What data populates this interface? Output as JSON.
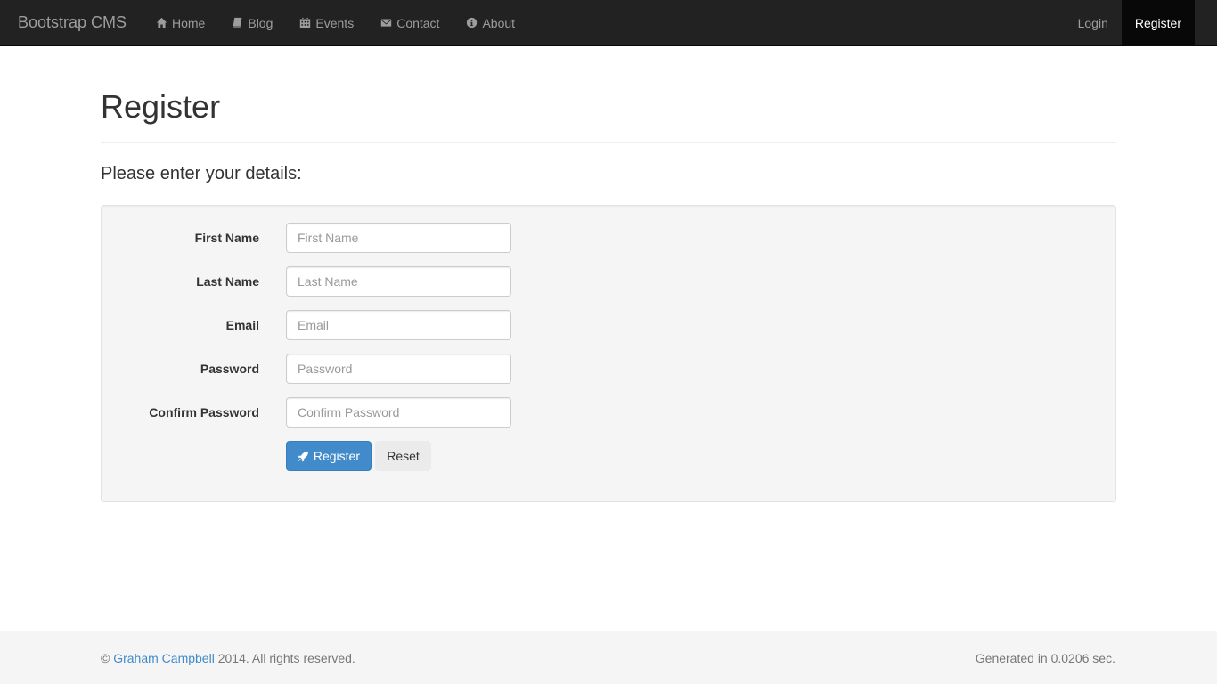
{
  "navbar": {
    "brand": "Bootstrap CMS",
    "links": [
      {
        "label": "Home",
        "icon": "home-icon"
      },
      {
        "label": "Blog",
        "icon": "book-icon"
      },
      {
        "label": "Events",
        "icon": "calendar-icon"
      },
      {
        "label": "Contact",
        "icon": "envelope-icon"
      },
      {
        "label": "About",
        "icon": "info-icon"
      }
    ],
    "right": {
      "login": "Login",
      "register": "Register"
    }
  },
  "page": {
    "title": "Register",
    "subtitle": "Please enter your details:"
  },
  "form": {
    "fields": [
      {
        "label": "First Name",
        "placeholder": "First Name"
      },
      {
        "label": "Last Name",
        "placeholder": "Last Name"
      },
      {
        "label": "Email",
        "placeholder": "Email"
      },
      {
        "label": "Password",
        "placeholder": "Password"
      },
      {
        "label": "Confirm Password",
        "placeholder": "Confirm Password"
      }
    ],
    "submit_label": "Register",
    "reset_label": "Reset"
  },
  "footer": {
    "copyright_symbol": "©",
    "author": "Graham Campbell",
    "rights": "2014. All rights reserved.",
    "generated": "Generated in 0.0206 sec."
  },
  "colors": {
    "navbar_bg": "#222222",
    "primary": "#428bca",
    "link": "#428bca"
  }
}
